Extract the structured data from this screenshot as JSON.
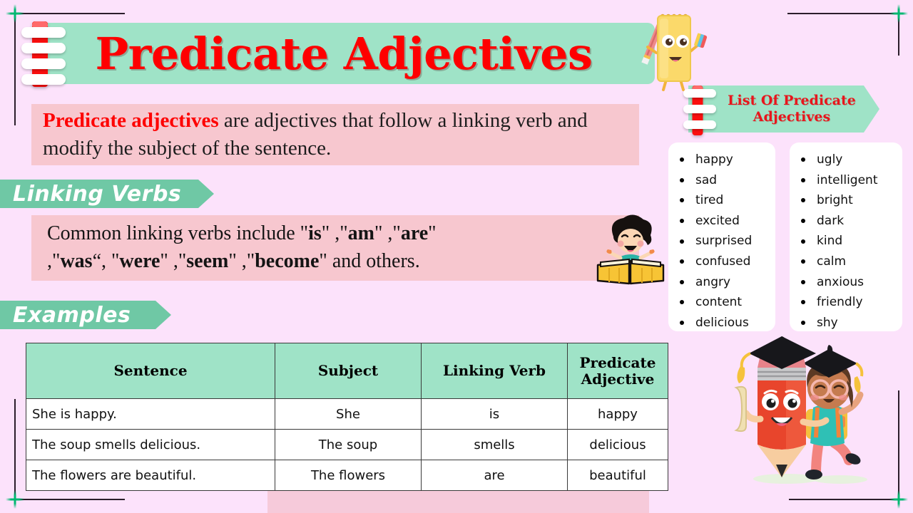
{
  "page": {
    "background_color": "#fce2fb",
    "accent_green": "#9fe3c7",
    "accent_pink": "#f7c7cf",
    "accent_red": "#fe0000"
  },
  "header": {
    "title": "Predicate Adjectives"
  },
  "definition": {
    "highlight": "Predicate adjectives",
    "rest": " are adjectives that follow a linking verb and modify the subject of the sentence."
  },
  "sections": {
    "linking_verbs_tag": "Linking Verbs",
    "examples_tag": "Examples"
  },
  "linking_verbs": {
    "line1_pre": "Common linking verbs include \"",
    "verb1": "is",
    "line1_mid1": "\" ,\"",
    "verb2": "am",
    "line1_mid2": "\" ,\"",
    "verb3": "are",
    "line1_end": "\"",
    "line2_pre": " ,\"",
    "verb4": "was",
    "line2_mid1": "“, \"",
    "verb5": "were",
    "line2_mid2": "\" ,\"",
    "verb6": "seem",
    "line2_mid3": "\" ,\"",
    "verb7": "become",
    "line2_end": "\" and others."
  },
  "list_panel": {
    "banner_line1": "List Of Predicate",
    "banner_line2": "Adjectives",
    "column_left": [
      "happy",
      "sad",
      "tired",
      "excited",
      "surprised",
      "confused",
      "angry",
      "content",
      "delicious"
    ],
    "column_right": [
      "ugly",
      "intelligent",
      "bright",
      "dark",
      "kind",
      "calm",
      "anxious",
      "friendly",
      "shy"
    ]
  },
  "examples_table": {
    "headers": [
      "Sentence",
      "Subject",
      "Linking Verb",
      "Predicate Adjective"
    ],
    "header_4_line1": "Predicate",
    "header_4_line2": "Adjective",
    "rows": [
      {
        "sentence": "She is happy.",
        "subject": "She",
        "linking_verb": "is",
        "predicate_adjective": "happy"
      },
      {
        "sentence": "The soup smells delicious.",
        "subject": "The soup",
        "linking_verb": "smells",
        "predicate_adjective": "delicious"
      },
      {
        "sentence": "The flowers are beautiful.",
        "subject": "The flowers",
        "linking_verb": "are",
        "predicate_adjective": "beautiful"
      }
    ]
  },
  "decorations": {
    "notepad_mascot": "notepad-character-icon",
    "reading_kid": "child-reading-book-icon",
    "graduates": "pencil-and-girl-graduate-icon",
    "star": "four-point-star-icon",
    "clip": "spiral-clip-icon"
  }
}
